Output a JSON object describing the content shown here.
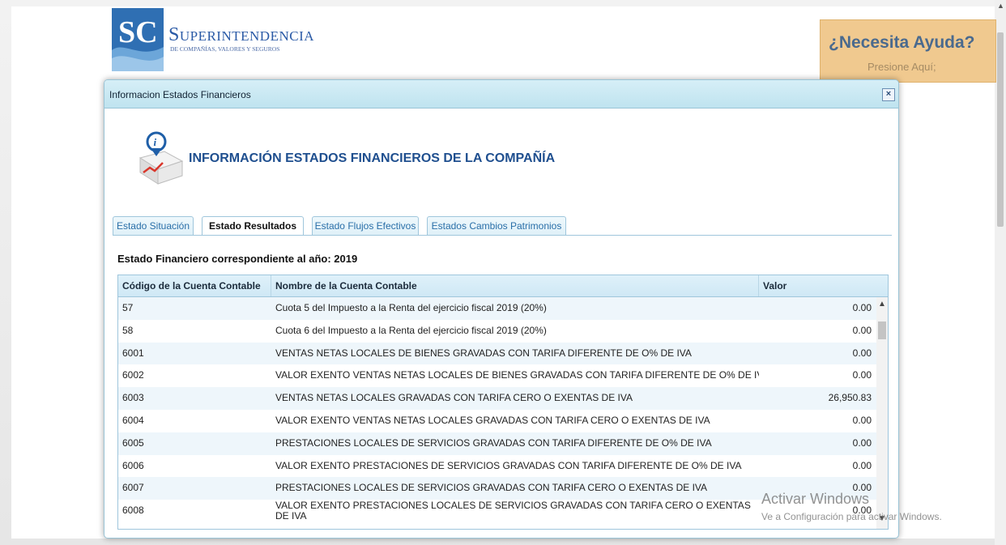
{
  "header": {
    "logo_letters": "SC",
    "logo_name": "Superintendencia",
    "logo_sub": "DE COMPAÑÍAS, VALORES Y SEGUROS"
  },
  "help": {
    "title": "¿Necesita Ayuda?",
    "subtitle": "Presione Aquí;"
  },
  "dialog": {
    "title": "Informacion Estados Financieros",
    "close_label": "×",
    "heading": "INFORMACIÓN ESTADOS FINANCIEROS DE LA COMPAÑÍA",
    "tabs": [
      {
        "label": "Estado Situación",
        "active": false
      },
      {
        "label": "Estado Resultados",
        "active": true
      },
      {
        "label": "Estado Flujos Efectivos",
        "active": false
      },
      {
        "label": "Estados Cambios Patrimonios",
        "active": false
      }
    ],
    "year_label": "Estado Financiero correspondiente al año: 2019",
    "columns": [
      "Código de la Cuenta Contable",
      "Nombre de la Cuenta Contable",
      "Valor"
    ],
    "rows": [
      {
        "code": "57",
        "name": "Cuota 5 del Impuesto a la Renta del ejercicio fiscal 2019 (20%)",
        "value": "0.00"
      },
      {
        "code": "58",
        "name": "Cuota 6 del Impuesto a la Renta del ejercicio fiscal 2019 (20%)",
        "value": "0.00"
      },
      {
        "code": "6001",
        "name": "VENTAS NETAS LOCALES DE BIENES GRAVADAS CON TARIFA DIFERENTE DE O% DE IVA",
        "value": "0.00"
      },
      {
        "code": "6002",
        "name": "VALOR EXENTO VENTAS NETAS LOCALES DE BIENES GRAVADAS CON TARIFA DIFERENTE DE O% DE IVA",
        "value": "0.00"
      },
      {
        "code": "6003",
        "name": "VENTAS NETAS LOCALES GRAVADAS CON TARIFA CERO O EXENTAS DE IVA",
        "value": "26,950.83"
      },
      {
        "code": "6004",
        "name": "VALOR EXENTO VENTAS NETAS LOCALES GRAVADAS CON TARIFA CERO O EXENTAS DE IVA",
        "value": "0.00"
      },
      {
        "code": "6005",
        "name": "PRESTACIONES LOCALES DE SERVICIOS GRAVADAS CON TARIFA DIFERENTE DE O% DE IVA",
        "value": "0.00"
      },
      {
        "code": "6006",
        "name": "VALOR EXENTO PRESTACIONES DE SERVICIOS GRAVADAS CON TARIFA DIFERENTE DE O% DE IVA",
        "value": "0.00"
      },
      {
        "code": "6007",
        "name": "PRESTACIONES LOCALES DE SERVICIOS GRAVADAS CON TARIFA CERO O EXENTAS DE IVA",
        "value": "0.00"
      },
      {
        "code": "6008",
        "name": "VALOR EXENTO PRESTACIONES LOCALES DE SERVICIOS GRAVADAS CON TARIFA CERO O EXENTAS DE IVA",
        "value": "0.00"
      }
    ]
  },
  "watermark": {
    "title": "Activar Windows",
    "subtitle": "Ve a Configuración para activar Windows."
  },
  "colors": {
    "accent": "#1f4f8f",
    "header_bg": "#bfe3ef",
    "help_bg": "#f0c98f",
    "row_alt": "#eef6fb"
  }
}
